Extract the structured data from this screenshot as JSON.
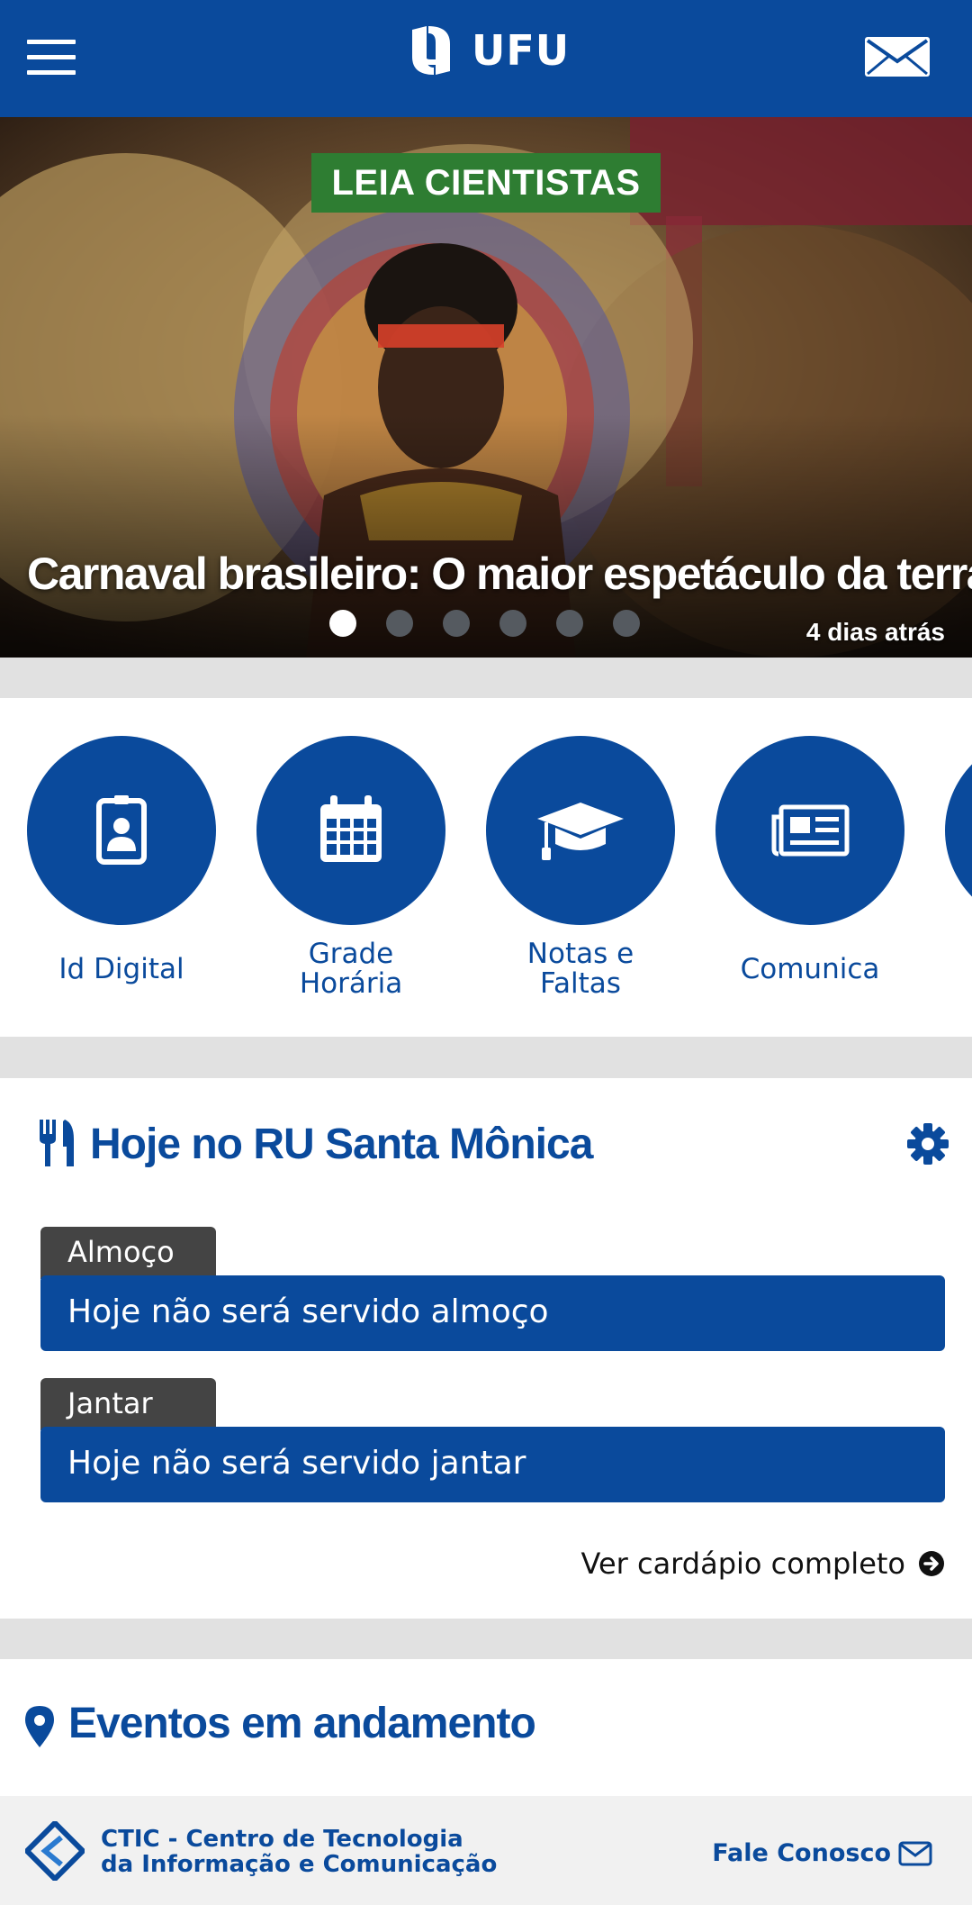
{
  "header": {
    "logo_text": "UFU",
    "menu_icon": "hamburger-menu-icon",
    "mail_icon": "envelope-icon"
  },
  "hero": {
    "tag": "LEIA CIENTISTAS",
    "title": "Carnaval brasileiro: O maior espetáculo da terra",
    "time": "4 dias atrás",
    "slides_count": 6,
    "active_slide": 1
  },
  "shortcuts": [
    {
      "label": "Id Digital",
      "icon": "id-badge-icon"
    },
    {
      "label": "Grade Horária",
      "icon": "calendar-icon"
    },
    {
      "label": "Notas e Faltas",
      "icon": "graduation-cap-icon"
    },
    {
      "label": "Comunica",
      "icon": "newspaper-icon"
    }
  ],
  "ru": {
    "title": "Hoje no RU Santa Mônica",
    "meals": [
      {
        "label": "Almoço",
        "text": "Hoje não será servido almoço"
      },
      {
        "label": "Jantar",
        "text": "Hoje não será servido jantar"
      }
    ],
    "link": "Ver cardápio completo"
  },
  "eventos": {
    "title": "Eventos em andamento"
  },
  "footer": {
    "org_line1": "CTIC - Centro de Tecnologia",
    "org_line2": "da Informação e Comunicação",
    "contact": "Fale Conosco"
  },
  "colors": {
    "primary": "#0a4a9c",
    "tag_green": "#2e7d32",
    "meal_tab": "#444444",
    "section_gap": "#e1e1e1"
  }
}
